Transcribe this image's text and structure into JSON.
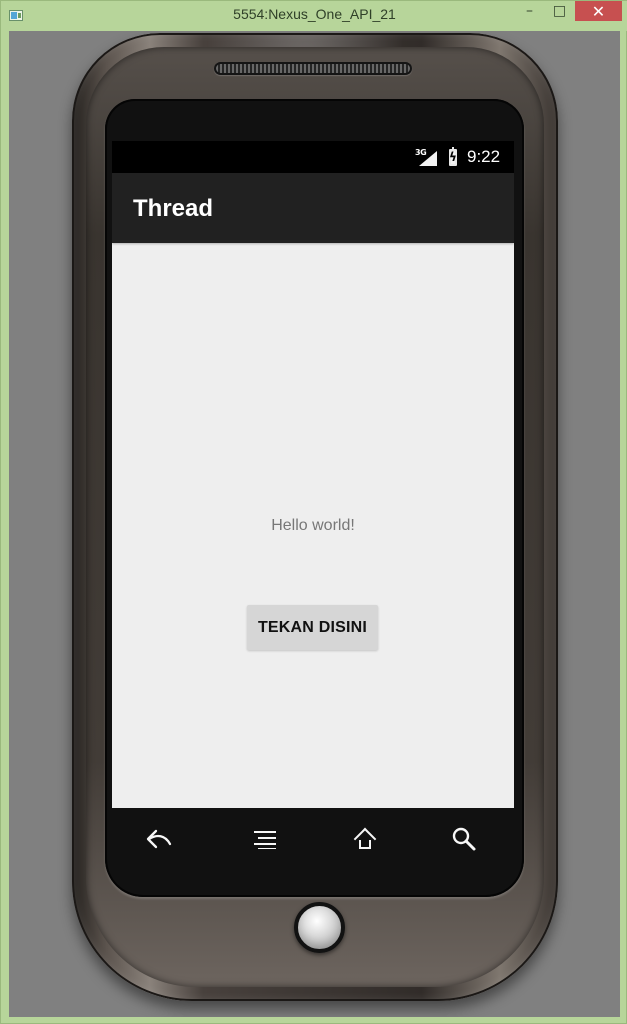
{
  "window": {
    "title": "5554:Nexus_One_API_21",
    "buttons": {
      "minimize": "–",
      "maximize": "□",
      "close": "✕"
    }
  },
  "device": {
    "status_bar": {
      "network": "3G",
      "time": "9:22"
    },
    "app": {
      "title": "Thread",
      "message": "Hello world!",
      "button_label": "TEKAN DISINI"
    },
    "navigation": {
      "back_icon": "back-icon",
      "menu_icon": "menu-icon",
      "home_icon": "home-icon",
      "search_icon": "search-icon"
    }
  },
  "colors": {
    "window_background": "#b7d59a",
    "emulator_background": "#808080",
    "status_bar": "#000000",
    "action_bar": "#212121",
    "content_background": "#eeeeee",
    "button_background": "#d6d6d6",
    "window_close": "#c75050"
  }
}
